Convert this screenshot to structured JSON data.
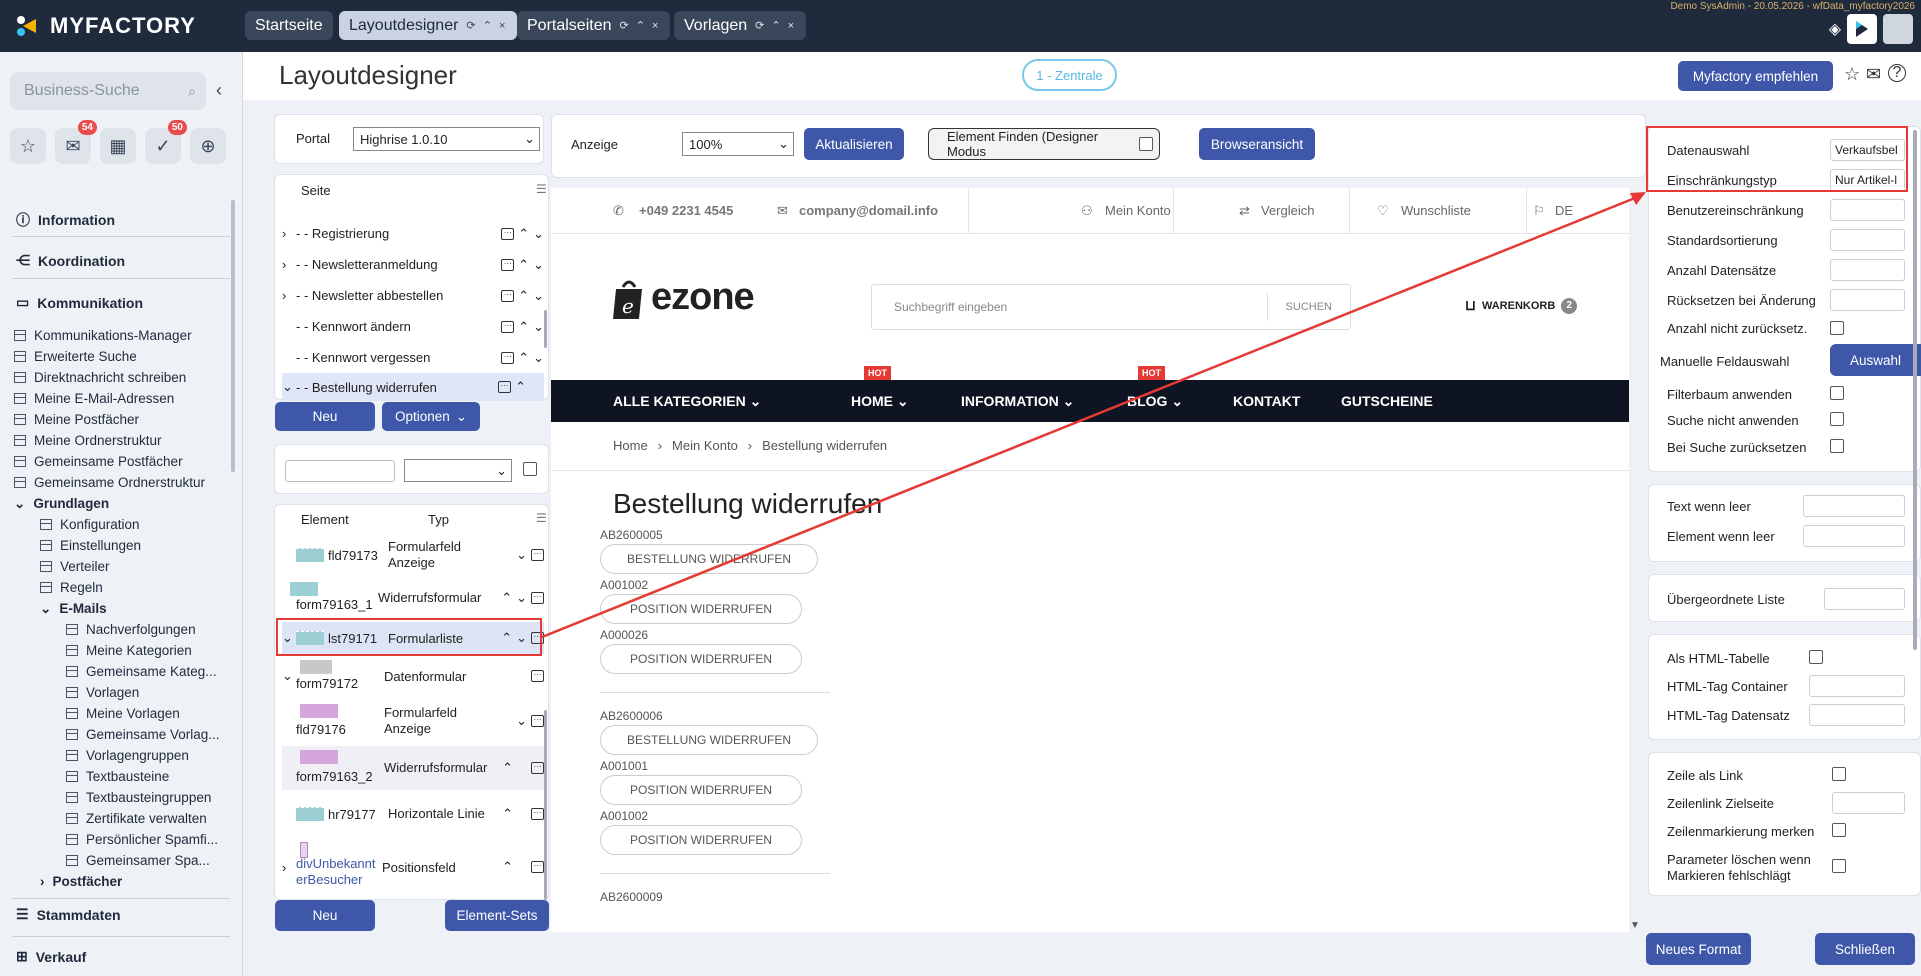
{
  "topbar": {
    "logo": "MYFACTORY",
    "tabs": [
      {
        "label": "Startseite"
      },
      {
        "label": "Layoutdesigner"
      },
      {
        "label": "Portalseiten"
      },
      {
        "label": "Vorlagen"
      }
    ],
    "tab_controls": "⟳ ⌃ ×",
    "session_info": "Demo SysAdmin - 20.05.2026 - wfData_myfactory2026"
  },
  "sidebar": {
    "search_placeholder": "Business-Suche",
    "quick_badges": {
      "mail": "54",
      "tasks": "50"
    },
    "sections": {
      "information": "Information",
      "koordination": "Koordination",
      "kommunikation": "Kommunikation",
      "stammdaten": "Stammdaten",
      "verkauf": "Verkauf"
    },
    "items": [
      "Kommunikations-Manager",
      "Erweiterte Suche",
      "Direktnachricht schreiben",
      "Meine E-Mail-Adressen",
      "Meine Postfächer",
      "Meine Ordnerstruktur",
      "Gemeinsame Postfächer",
      "Gemeinsame Ordnerstruktur"
    ],
    "grundlagen": "Grundlagen",
    "grundlagen_items": [
      "Konfiguration",
      "Einstellungen",
      "Verteiler",
      "Regeln"
    ],
    "emails": "E-Mails",
    "email_items": [
      "Nachverfolgungen",
      "Meine Kategorien",
      "Gemeinsame Kateg...",
      "Vorlagen",
      "Meine Vorlagen",
      "Gemeinsame Vorlag...",
      "Vorlagengruppen",
      "Textbausteine",
      "Textbausteingruppen",
      "Zertifikate verwalten",
      "Persönlicher Spamfi...",
      "Gemeinsamer Spa..."
    ],
    "postfaecher": "Postfächer"
  },
  "header": {
    "title": "Layoutdesigner",
    "zentrale": "1 - Zentrale",
    "empfehlen": "Myfactory empfehlen"
  },
  "left": {
    "portal_label": "Portal",
    "portal_value": "Highrise 1.0.10",
    "seite_header": "Seite",
    "pages": [
      {
        "label": "- - Registrierung",
        "expand": "›"
      },
      {
        "label": "- - Newsletteranmeldung",
        "expand": "›"
      },
      {
        "label": "- - Newsletter abbestellen",
        "expand": "›"
      },
      {
        "label": "- - Kennwort ändern",
        "expand": ""
      },
      {
        "label": "- - Kennwort vergessen",
        "expand": ""
      },
      {
        "label": "- - Bestellung widerrufen",
        "expand": "⌄"
      }
    ],
    "neu": "Neu",
    "optionen": "Optionen",
    "element_header": "Element",
    "typ_header": "Typ",
    "elements": [
      {
        "name": "fld79173",
        "typ": "Formularfeld Anzeige"
      },
      {
        "name": "form79163_1",
        "typ": "Widerrufsformular"
      },
      {
        "name": "lst79171",
        "typ": "Formularliste"
      },
      {
        "name": "form79172",
        "typ": "Datenformular"
      },
      {
        "name": "fld79176",
        "typ": "Formularfeld Anzeige"
      },
      {
        "name": "form79163_2",
        "typ": "Widerrufsformular"
      },
      {
        "name": "hr79177",
        "typ": "Horizontale Linie"
      },
      {
        "name": "divUnbekannterBesucher",
        "typ": "Positionsfeld"
      }
    ],
    "neu2": "Neu",
    "element_sets": "Element-Sets"
  },
  "toolbar": {
    "anzeige_label": "Anzeige",
    "zoom": "100%",
    "aktualisieren": "Aktualisieren",
    "element_finden": "Element Finden (Designer Modus",
    "browseransicht": "Browseransicht"
  },
  "preview": {
    "phone": "+049 2231 4545",
    "email": "company@domail.info",
    "mein_konto": "Mein Konto",
    "vergleich": "Vergleich",
    "wunschliste": "Wunschliste",
    "lang": "DE",
    "brand": "ezone",
    "search_placeholder": "Suchbegriff eingeben",
    "suchen": "SUCHEN",
    "warenkorb": "WARENKORB",
    "cart_count": "2",
    "nav": [
      "ALLE KATEGORIEN",
      "HOME",
      "INFORMATION",
      "BLOG",
      "KONTAKT",
      "GUTSCHEINE"
    ],
    "hot": "HOT",
    "breadcrumb": [
      "Home",
      "Mein Konto",
      "Bestellung widerrufen"
    ],
    "heading": "Bestellung widerrufen",
    "orders": [
      {
        "code": "AB2600005",
        "btn": "BESTELLUNG WIDERRUFEN",
        "positions": [
          {
            "code": "A001002",
            "btn": "POSITION WIDERRUFEN"
          },
          {
            "code": "A000026",
            "btn": "POSITION WIDERRUFEN"
          }
        ]
      },
      {
        "code": "AB2600006",
        "btn": "BESTELLUNG WIDERRUFEN",
        "positions": [
          {
            "code": "A001001",
            "btn": "POSITION WIDERRUFEN"
          },
          {
            "code": "A001002",
            "btn": "POSITION WIDERRUFEN"
          }
        ]
      },
      {
        "code": "AB2600009",
        "btn": "",
        "positions": []
      }
    ]
  },
  "props": {
    "datenauswahl": "Datenauswahl",
    "datenauswahl_value": "Verkaufsbel",
    "einschraenkungstyp": "Einschränkungstyp",
    "einschraenkungstyp_value": "Nur Artikel-l",
    "benutzereinschraenkung": "Benutzereinschränkung",
    "standardsortierung": "Standardsortierung",
    "anzahl_datensaetze": "Anzahl Datensätze",
    "ruecksetzen": "Rücksetzen bei Änderung",
    "anzahl_nicht": "Anzahl nicht zurücksetz.",
    "manuelle": "Manuelle Feldauswahl",
    "auswahl": "Auswahl",
    "filterbaum": "Filterbaum anwenden",
    "suche_nicht": "Suche nicht anwenden",
    "bei_suche": "Bei Suche zurücksetzen",
    "text_leer": "Text wenn leer",
    "element_leer": "Element wenn leer",
    "uebergeordnete": "Übergeordnete Liste",
    "html_tabelle": "Als HTML-Tabelle",
    "html_container": "HTML-Tag Container",
    "html_datensatz": "HTML-Tag Datensatz",
    "zeile_link": "Zeile als Link",
    "zeilenlink_ziel": "Zeilenlink Zielseite",
    "zeilenmarkierung": "Zeilenmarkierung merken",
    "parameter_loeschen": "Parameter löschen wenn Markieren fehlschlägt",
    "neues_format": "Neues Format",
    "schliessen": "Schließen"
  },
  "colors": {
    "topbar": "#1f2a3c",
    "accent": "#3e57a8",
    "highlight": "#e53935",
    "nav_dark": "#0f1422",
    "hot": "#e53935"
  }
}
